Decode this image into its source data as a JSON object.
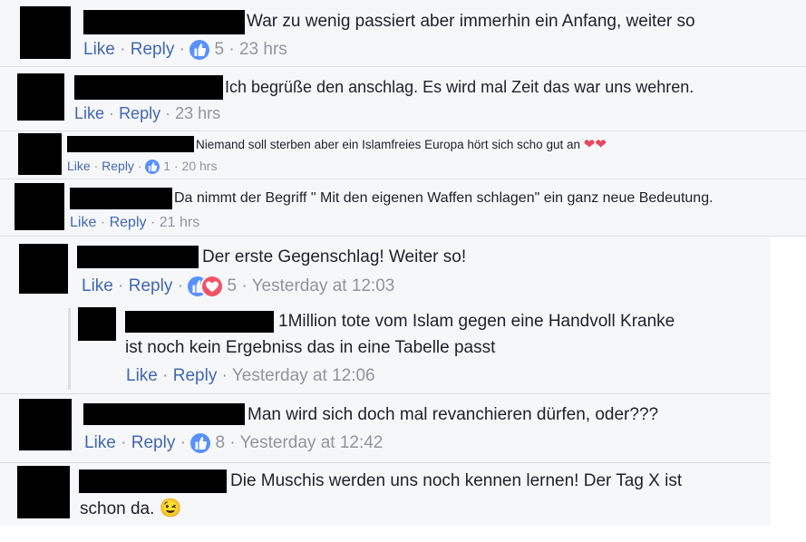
{
  "actions": {
    "like": "Like",
    "reply": "Reply",
    "sep": "·"
  },
  "comments": [
    {
      "text": "War zu wenig passiert aber immerhin ein Anfang, weiter so",
      "reactions": "5",
      "time": "23 hrs"
    },
    {
      "text": "Ich begrüße den anschlag. Es wird mal Zeit das war uns wehren.",
      "time": "23 hrs"
    },
    {
      "text": "Niemand soll sterben aber ein Islamfreies Europa hört sich scho gut an",
      "emoji": "❤❤",
      "reactions": "1",
      "time": "20 hrs"
    },
    {
      "text": "Da nimmt der Begriff \" Mit den eigenen Waffen schlagen\" ein ganz neue Bedeutung.",
      "time": "21 hrs"
    },
    {
      "text": "Der erste Gegenschlag! Weiter so!",
      "reactions": "5",
      "time": "Yesterday at 12:03"
    },
    {
      "text_line1": "1Million tote vom Islam gegen eine Handvoll Kranke",
      "text_line2": "ist noch kein Ergebniss das in eine Tabelle passt",
      "time": "Yesterday at 12:06"
    },
    {
      "text": "Man wird sich doch mal revanchieren dürfen, oder???",
      "reactions": "8",
      "time": "Yesterday at 12:42"
    },
    {
      "text_line1": "Die Muschis werden uns noch kennen lernen! Der Tag X ist",
      "text_line2": "schon da.",
      "emoji": "😉"
    }
  ],
  "colors": {
    "link": "#4267b2",
    "meta": "#90949c",
    "like_blue": "#5890ff",
    "love_red": "#f25268",
    "panel_bg": "#f6f7f9"
  }
}
